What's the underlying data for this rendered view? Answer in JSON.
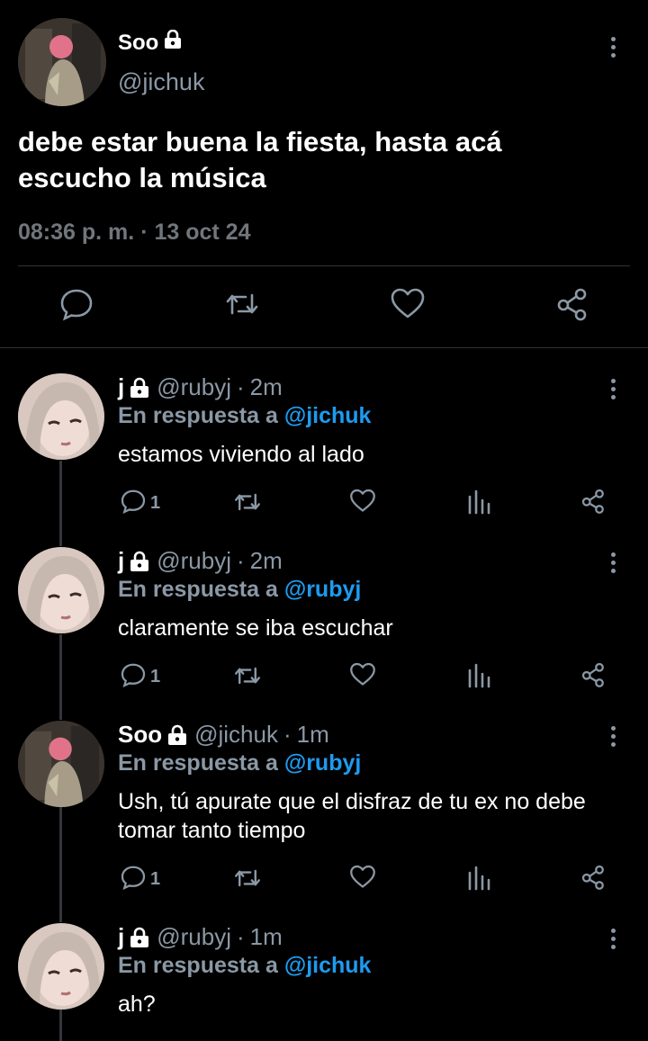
{
  "main_tweet": {
    "name": "Soo",
    "handle": "@jichuk",
    "text_line1": "debe estar buena la fiesta, hasta acá",
    "text_line2": "escucho la música",
    "time": "08:36 p. m.",
    "separator": "·",
    "date": "13 oct 24"
  },
  "replies": [
    {
      "name": "j",
      "handle": "@rubyj",
      "time": "2m",
      "reply_prefix": "En respuesta a",
      "reply_to": "@jichuk",
      "text": "estamos viviendo al lado",
      "reply_count": "1"
    },
    {
      "name": "j",
      "handle": "@rubyj",
      "time": "2m",
      "reply_prefix": "En respuesta a",
      "reply_to": "@rubyj",
      "text": "claramente se iba escuchar",
      "reply_count": "1"
    },
    {
      "name": "Soo",
      "handle": "@jichuk",
      "time": "1m",
      "reply_prefix": "En respuesta a",
      "reply_to": "@rubyj",
      "text": "Ush, tú apurate que el disfraz de tu ex no debe tomar tanto tiempo",
      "reply_count": "1"
    },
    {
      "name": "j",
      "handle": "@rubyj",
      "time": "1m",
      "reply_prefix": "En respuesta a",
      "reply_to": "@jichuk",
      "text": "ah?",
      "reply_count": ""
    }
  ],
  "icons": {
    "lock": "lock-icon",
    "more": "more-vertical-icon",
    "reply": "comment-icon",
    "retweet": "retweet-icon",
    "like": "heart-icon",
    "views": "bar-chart-icon",
    "share": "share-icon"
  },
  "colors": {
    "background": "#000000",
    "text": "#ffffff",
    "muted": "#8b98a5",
    "mention": "#1d9bf0",
    "divider": "#2f3336"
  }
}
